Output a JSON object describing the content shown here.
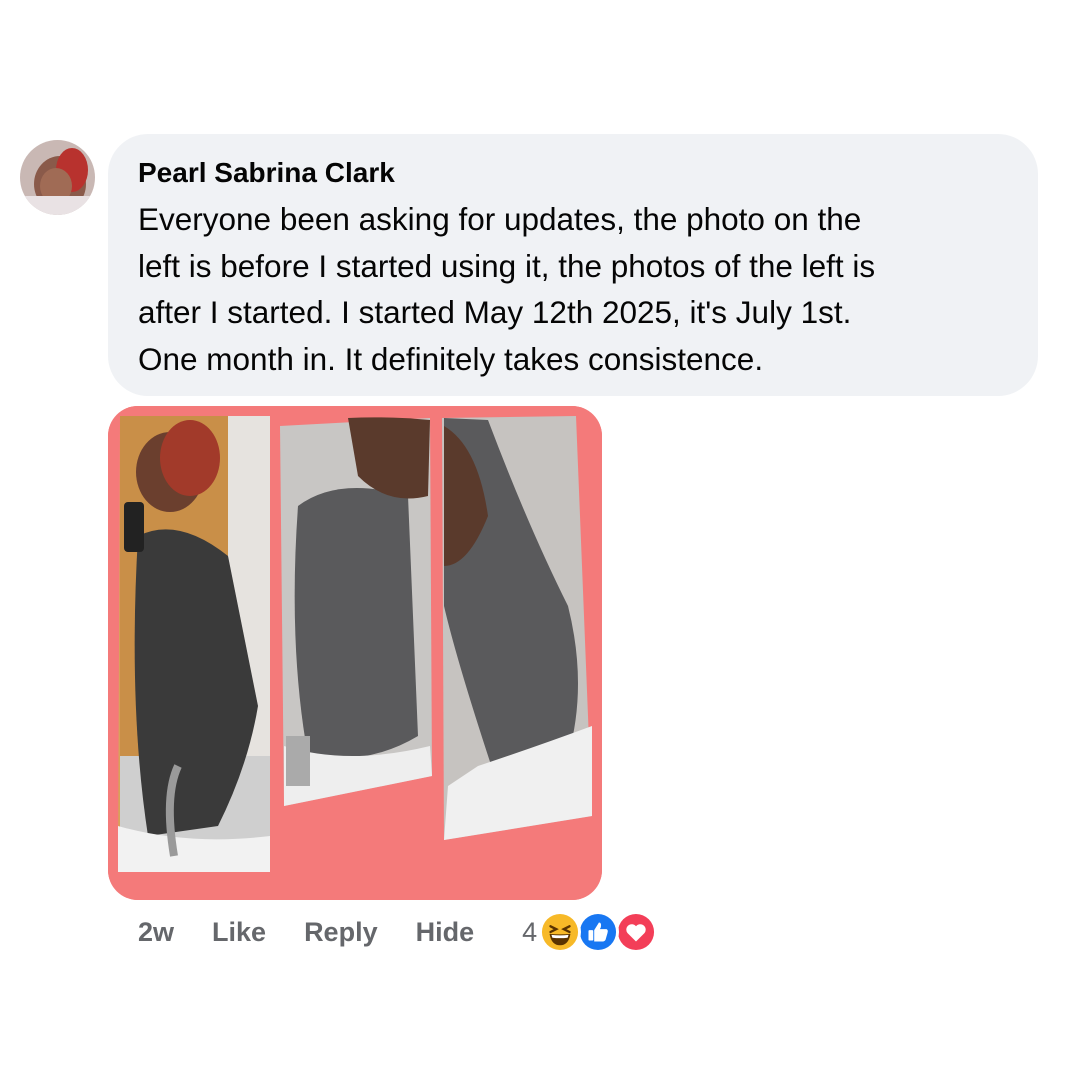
{
  "comment": {
    "author": "Pearl Sabrina Clark",
    "text": "Everyone been asking for updates, the photo on the\nleft is before I started using it, the photos of the left is\nafter I started. I started May 12th 2025, it's July 1st.\nOne month in. It definitely takes consistence.",
    "timestamp": "2w",
    "actions": {
      "like": "Like",
      "reply": "Reply",
      "hide": "Hide"
    },
    "reactions": {
      "count": "4",
      "icons": [
        "laughing-emoji-icon",
        "thumbs-up-icon",
        "heart-icon"
      ]
    }
  },
  "colors": {
    "bubble": "#f0f2f5",
    "secondary_text": "#65676b",
    "like_blue": "#1877f2",
    "love_red": "#f33e58",
    "photo_bg": "#f47a7a"
  }
}
